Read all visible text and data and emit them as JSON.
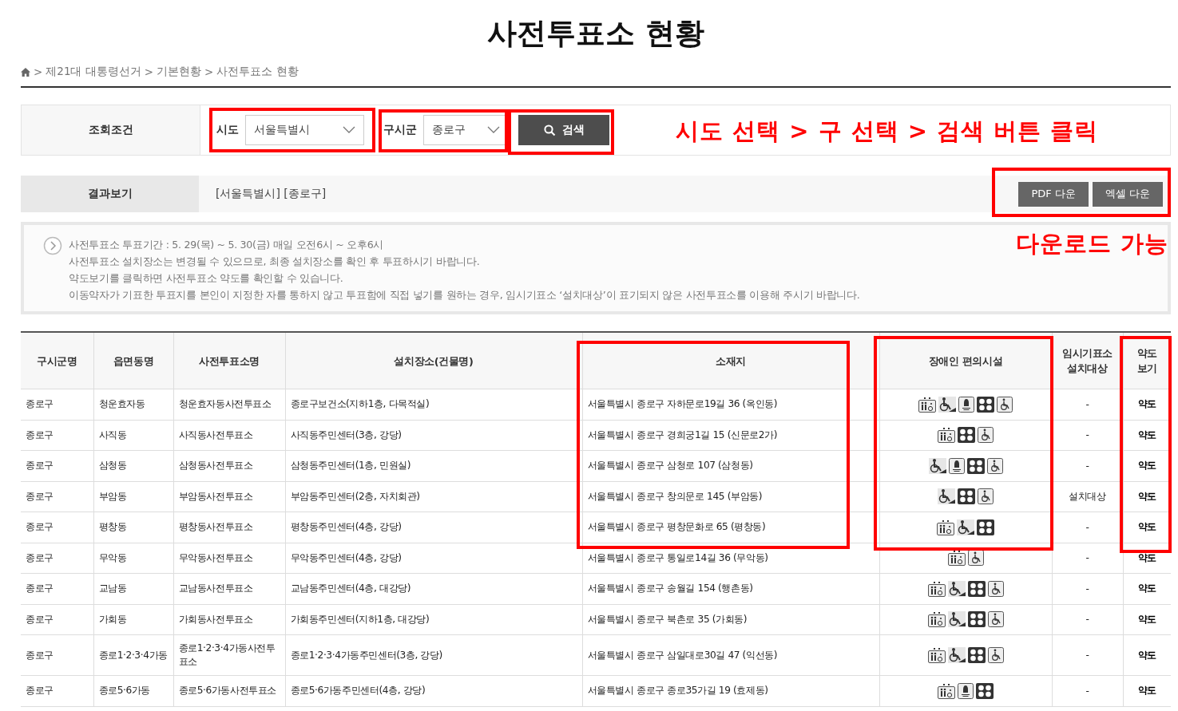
{
  "page_title": "사전투표소 현황",
  "breadcrumb": {
    "separator": ">",
    "items": [
      "제21대 대통령선거",
      "기본현황",
      "사전투표소 현황"
    ]
  },
  "search": {
    "label": "조회조건",
    "fields": [
      {
        "label": "시도",
        "value": "서울특별시"
      },
      {
        "label": "구시군",
        "value": "종로구"
      }
    ],
    "button": "검색"
  },
  "result": {
    "label": "결과보기",
    "value": "[서울특별시] [종로구]",
    "buttons": [
      "PDF 다운",
      "엑셀 다운"
    ]
  },
  "notices": [
    "사전투표소 투표기간 : 5. 29(목) ~ 5. 30(금) 매일 오전6시 ~ 오후6시",
    "사전투표소 설치장소는 변경될 수 있으므로, 최종 설치장소를 확인 후 투표하시기 바랍니다.",
    "약도보기를 클릭하면 사전투표소 약도를 확인할 수 있습니다.",
    "이동약자가 기표한 투표지를 본인이 지정한 자를 통하지 않고 투표함에 직접 넣기를 원하는 경우, 임시기표소 ‘설치대상’이 표기되지 않은 사전투표소를 이용해 주시기 바랍니다."
  ],
  "table": {
    "columns": [
      "구시군명",
      "읍면동명",
      "사전투표소명",
      "설치장소(건물명)",
      "소재지",
      "장애인 편의시설",
      "임시기표소\n설치대상",
      "약도\n보기"
    ],
    "rows": [
      {
        "cells": [
          "종로구",
          "청운효자동",
          "청운효자동사전투표소",
          "종로구보건소(지하1층, 다목적실)",
          "서울특별시 종로구 자하문로19길 36 (옥인동)"
        ],
        "facilities": [
          {
            "kind": "restroom"
          },
          {
            "kind": "ramp"
          },
          {
            "kind": "bell"
          },
          {
            "kind": "braille"
          },
          {
            "kind": "wheelchair"
          }
        ],
        "temp_booth": "-",
        "map": "약도"
      },
      {
        "cells": [
          "종로구",
          "사직동",
          "사직동사전투표소",
          "사직동주민센터(3층, 강당)",
          "서울특별시 종로구 경희궁1길 15 (신문로2가)"
        ],
        "facilities": [
          {
            "kind": "restroom"
          },
          {
            "kind": "braille"
          },
          {
            "kind": "wheelchair"
          }
        ],
        "temp_booth": "-",
        "map": "약도"
      },
      {
        "cells": [
          "종로구",
          "삼청동",
          "삼청동사전투표소",
          "삼청동주민센터(1층, 민원실)",
          "서울특별시 종로구 삼청로 107 (삼청동)"
        ],
        "facilities": [
          {
            "kind": "ramp"
          },
          {
            "kind": "bell"
          },
          {
            "kind": "braille"
          },
          {
            "kind": "wheelchair"
          }
        ],
        "temp_booth": "-",
        "map": "약도"
      },
      {
        "cells": [
          "종로구",
          "부암동",
          "부암동사전투표소",
          "부암동주민센터(2층, 자치회관)",
          "서울특별시 종로구 창의문로 145 (부암동)"
        ],
        "facilities": [
          {
            "kind": "ramp"
          },
          {
            "kind": "braille"
          },
          {
            "kind": "wheelchair"
          }
        ],
        "temp_booth": "설치대상",
        "map": "약도"
      },
      {
        "cells": [
          "종로구",
          "평창동",
          "평창동사전투표소",
          "평창동주민센터(4층, 강당)",
          "서울특별시 종로구 평창문화로 65 (평창동)"
        ],
        "facilities": [
          {
            "kind": "restroom"
          },
          {
            "kind": "ramp"
          },
          {
            "kind": "braille"
          }
        ],
        "temp_booth": "-",
        "map": "약도"
      },
      {
        "cells": [
          "종로구",
          "무악동",
          "무악동사전투표소",
          "무악동주민센터(4층, 강당)",
          "서울특별시 종로구 통일로14길 36 (무악동)"
        ],
        "facilities": [
          {
            "kind": "restroom"
          },
          {
            "kind": "wheelchair"
          }
        ],
        "temp_booth": "-",
        "map": "약도"
      },
      {
        "cells": [
          "종로구",
          "교남동",
          "교남동사전투표소",
          "교남동주민센터(4층, 대강당)",
          "서울특별시 종로구 송월길 154 (행촌동)"
        ],
        "facilities": [
          {
            "kind": "restroom"
          },
          {
            "kind": "ramp"
          },
          {
            "kind": "braille"
          },
          {
            "kind": "wheelchair"
          }
        ],
        "temp_booth": "-",
        "map": "약도"
      },
      {
        "cells": [
          "종로구",
          "가회동",
          "가회동사전투표소",
          "가회동주민센터(지하1층, 대강당)",
          "서울특별시 종로구 북촌로 35 (가회동)"
        ],
        "facilities": [
          {
            "kind": "restroom"
          },
          {
            "kind": "ramp"
          },
          {
            "kind": "braille"
          },
          {
            "kind": "wheelchair"
          }
        ],
        "temp_booth": "-",
        "map": "약도"
      },
      {
        "cells": [
          "종로구",
          "종로1·2·3·4가동",
          "종로1·2·3·4가동사전투표소",
          "종로1·2·3·4가동주민센터(3층, 강당)",
          "서울특별시 종로구 삼일대로30길 47 (익선동)"
        ],
        "facilities": [
          {
            "kind": "restroom"
          },
          {
            "kind": "ramp"
          },
          {
            "kind": "braille"
          },
          {
            "kind": "wheelchair"
          }
        ],
        "temp_booth": "-",
        "map": "약도"
      },
      {
        "cells": [
          "종로구",
          "종로5·6가동",
          "종로5·6가동사전투표소",
          "종로5·6가동주민센터(4층, 강당)",
          "서울특별시 종로구 종로35가길 19 (효제동)"
        ],
        "facilities": [
          {
            "kind": "restroom"
          },
          {
            "kind": "bell"
          },
          {
            "kind": "braille"
          }
        ],
        "temp_booth": "-",
        "map": "약도"
      }
    ]
  },
  "annotations": [
    "시도 선택 > 구 선택 > 검색 버튼 클릭",
    "다운로드 가능"
  ]
}
